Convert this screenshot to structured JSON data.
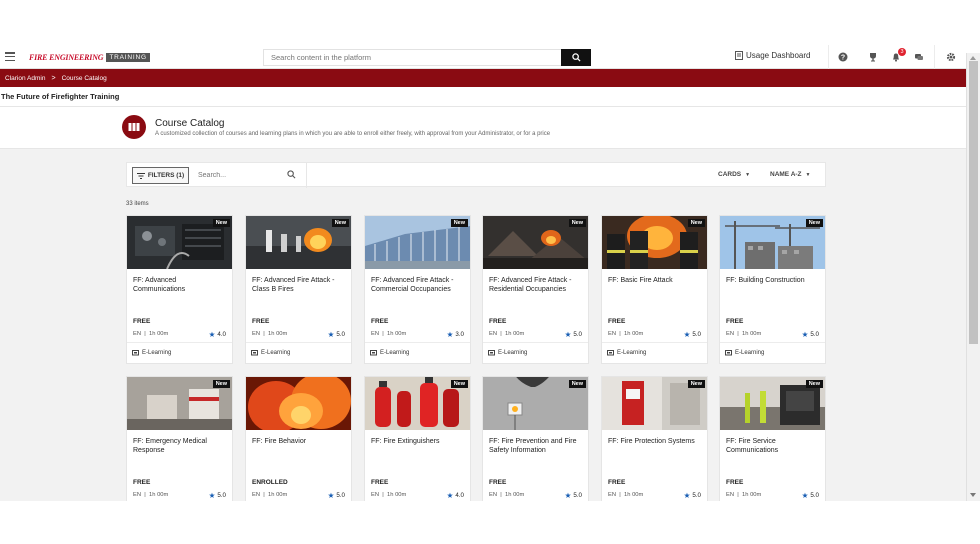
{
  "header": {
    "logo_main": "FIRE ENGINEERING",
    "logo_sub": "TRAINING",
    "search_placeholder": "Search content in the platform",
    "usage_dashboard": "Usage Dashboard",
    "notification_count": "3"
  },
  "breadcrumb": {
    "root": "Clarion Admin",
    "separator": ">",
    "current": "Course Catalog"
  },
  "page_title": "The Future of Firefighter Training",
  "catalog": {
    "title": "Course Catalog",
    "description": "A customized collection of courses and learning plans in which you are able to enroll either freely, with approval from your Administrator, or for a price"
  },
  "filters": {
    "filters_label": "FILTERS (1)",
    "search_placeholder": "Search...",
    "view_label": "CARDS",
    "sort_label": "NAME A-Z"
  },
  "items_count": "33 items",
  "courses": [
    {
      "title": "FF: Advanced Communications",
      "new": "New",
      "price": "FREE",
      "lang": "EN",
      "duration": "1h 00m",
      "rating": "4.0",
      "type": "E-Learning"
    },
    {
      "title": "FF: Advanced Fire Attack - Class B Fires",
      "new": "New",
      "price": "FREE",
      "lang": "EN",
      "duration": "1h 00m",
      "rating": "5.0",
      "type": "E-Learning"
    },
    {
      "title": "FF: Advanced Fire Attack - Commercial Occupancies",
      "new": "New",
      "price": "FREE",
      "lang": "EN",
      "duration": "1h 00m",
      "rating": "3.0",
      "type": "E-Learning"
    },
    {
      "title": "FF: Advanced Fire Attack - Residential Occupancies",
      "new": "New",
      "price": "FREE",
      "lang": "EN",
      "duration": "1h 00m",
      "rating": "5.0",
      "type": "E-Learning"
    },
    {
      "title": "FF: Basic Fire Attack",
      "new": "New",
      "price": "FREE",
      "lang": "EN",
      "duration": "1h 00m",
      "rating": "5.0",
      "type": "E-Learning"
    },
    {
      "title": "FF: Building Construction",
      "new": "New",
      "price": "FREE",
      "lang": "EN",
      "duration": "1h 00m",
      "rating": "5.0",
      "type": "E-Learning"
    },
    {
      "title": "FF: Emergency Medical Response",
      "new": "New",
      "price": "FREE",
      "lang": "EN",
      "duration": "1h 00m",
      "rating": "5.0",
      "type": ""
    },
    {
      "title": "FF: Fire Behavior",
      "new": "",
      "price": "ENROLLED",
      "lang": "EN",
      "duration": "1h 00m",
      "rating": "5.0",
      "type": ""
    },
    {
      "title": "FF: Fire Extinguishers",
      "new": "New",
      "price": "FREE",
      "lang": "EN",
      "duration": "1h 00m",
      "rating": "4.0",
      "type": ""
    },
    {
      "title": "FF: Fire Prevention and Fire Safety Information",
      "new": "New",
      "price": "FREE",
      "lang": "EN",
      "duration": "1h 00m",
      "rating": "5.0",
      "type": ""
    },
    {
      "title": "FF: Fire Protection Systems",
      "new": "New",
      "price": "FREE",
      "lang": "EN",
      "duration": "1h 00m",
      "rating": "5.0",
      "type": ""
    },
    {
      "title": "FF: Fire Service Communications",
      "new": "New",
      "price": "FREE",
      "lang": "EN",
      "duration": "1h 00m",
      "rating": "5.0",
      "type": ""
    }
  ],
  "colors": {
    "brand_red": "#8a0b12",
    "logo_red": "#c8102e",
    "star_blue": "#1a5fb4"
  }
}
